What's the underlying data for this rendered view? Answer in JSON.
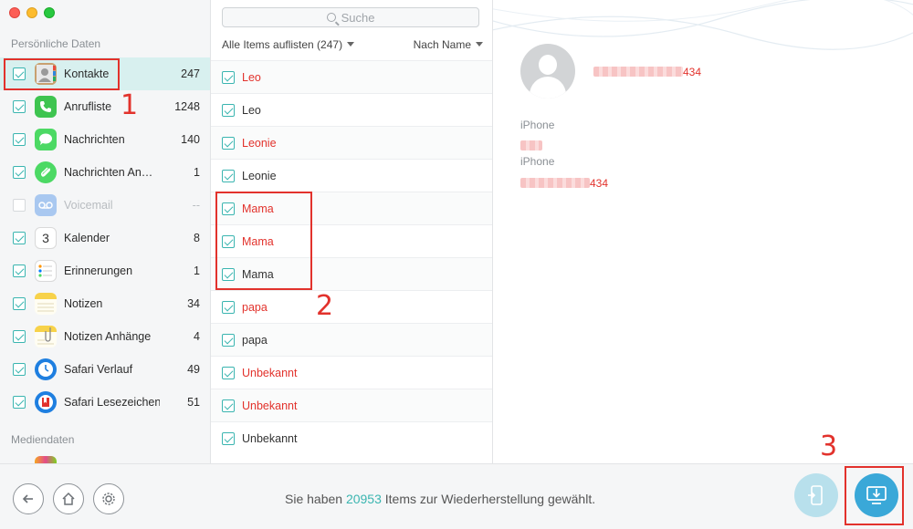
{
  "window": {
    "accent": "#3ab5b0",
    "deleted_color": "#e2322c"
  },
  "sidebar": {
    "section_personal": "Persönliche Daten",
    "section_media": "Mediendaten",
    "items": [
      {
        "label": "Kontakte",
        "count": "247",
        "icon": "contacts-icon",
        "checked": true,
        "active": true
      },
      {
        "label": "Anrufliste",
        "count": "1248",
        "icon": "phone-icon",
        "checked": true
      },
      {
        "label": "Nachrichten",
        "count": "140",
        "icon": "messages-icon",
        "checked": true
      },
      {
        "label": "Nachrichten An…",
        "count": "1",
        "icon": "message-attachments-icon",
        "checked": true
      },
      {
        "label": "Voicemail",
        "count": "--",
        "icon": "voicemail-icon",
        "checked": false,
        "disabled": true
      },
      {
        "label": "Kalender",
        "count": "8",
        "icon": "calendar-icon",
        "checked": true
      },
      {
        "label": "Erinnerungen",
        "count": "1",
        "icon": "reminders-icon",
        "checked": true
      },
      {
        "label": "Notizen",
        "count": "34",
        "icon": "notes-icon",
        "checked": true
      },
      {
        "label": "Notizen Anhänge",
        "count": "4",
        "icon": "notes-attachments-icon",
        "checked": true
      },
      {
        "label": "Safari Verlauf",
        "count": "49",
        "icon": "safari-history-icon",
        "checked": true
      },
      {
        "label": "Safari Lesezeichen",
        "count": "51",
        "icon": "safari-bookmarks-icon",
        "checked": true
      }
    ],
    "calendar_icon_day": "3"
  },
  "list": {
    "search_placeholder": "Suche",
    "filter_label": "Alle Items auflisten (247)",
    "sort_label": "Nach Name",
    "rows": [
      {
        "name": "Leo",
        "deleted": true
      },
      {
        "name": "Leo",
        "deleted": false
      },
      {
        "name": "Leonie",
        "deleted": true
      },
      {
        "name": "Leonie",
        "deleted": false
      },
      {
        "name": "Mama",
        "deleted": true
      },
      {
        "name": "Mama",
        "deleted": true
      },
      {
        "name": "Mama",
        "deleted": false
      },
      {
        "name": "papa",
        "deleted": true
      },
      {
        "name": "papa",
        "deleted": false
      },
      {
        "name": "Unbekannt",
        "deleted": true
      },
      {
        "name": "Unbekannt",
        "deleted": true
      },
      {
        "name": "Unbekannt",
        "deleted": false
      }
    ]
  },
  "detail": {
    "phone_partial_1": "434",
    "label_1": "iPhone",
    "label_2": "iPhone",
    "phone_partial_2": "434"
  },
  "footer": {
    "status_prefix": "Sie haben ",
    "status_count": "20953",
    "status_suffix": " Items zur Wiederherstellung gewählt.",
    "back_icon": "back-arrow-icon",
    "home_icon": "home-icon",
    "settings_icon": "gear-icon",
    "to_device_icon": "to-device-icon",
    "to_computer_icon": "download-to-computer-icon"
  },
  "annotations": [
    "1",
    "2",
    "3"
  ]
}
